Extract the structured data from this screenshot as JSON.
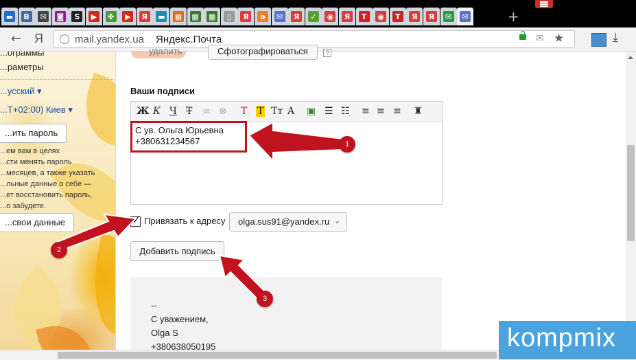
{
  "browser": {
    "tab_favicons": [
      {
        "glyph": "▬",
        "color": "#1e6fc9"
      },
      {
        "glyph": "В",
        "color": "#3b6ea5"
      },
      {
        "glyph": "✉",
        "color": "#444444"
      },
      {
        "glyph": "◙",
        "color": "#a0168c"
      },
      {
        "glyph": "S",
        "color": "#222222"
      },
      {
        "glyph": "▶",
        "color": "#d32a20"
      },
      {
        "glyph": "✤",
        "color": "#4a9a3a"
      },
      {
        "glyph": "▶",
        "color": "#d32a20"
      },
      {
        "glyph": "Я",
        "color": "#e03a3a"
      },
      {
        "glyph": "▬",
        "color": "#1e8fa8"
      },
      {
        "glyph": "▦",
        "color": "#e36c0a"
      },
      {
        "glyph": "▦",
        "color": "#3a7a2a"
      },
      {
        "glyph": "▦",
        "color": "#3a7a2a"
      },
      {
        "glyph": "▯",
        "color": "#999999"
      },
      {
        "glyph": "Я",
        "color": "#e03a3a"
      },
      {
        "glyph": "ə",
        "color": "#f08020"
      },
      {
        "glyph": "✉",
        "color": "#5a6fd0"
      },
      {
        "glyph": "Я",
        "color": "#e03a3a"
      },
      {
        "glyph": "✓",
        "color": "#58a030"
      },
      {
        "glyph": "◉",
        "color": "#d04040"
      },
      {
        "glyph": "Я",
        "color": "#e03a3a"
      },
      {
        "glyph": "T",
        "color": "#d02020"
      },
      {
        "glyph": "◉",
        "color": "#d04040"
      },
      {
        "glyph": "T",
        "color": "#d02020"
      },
      {
        "glyph": "Я",
        "color": "#e03a3a"
      },
      {
        "glyph": "Я",
        "color": "#e03a3a"
      },
      {
        "glyph": "✉",
        "color": "#2a9a4a"
      },
      {
        "glyph": "✉",
        "color": "#5a6fd0"
      }
    ],
    "back_glyph": "←",
    "yandex_btn": "Я",
    "url": "mail.yandex.ua",
    "page_title": "Яндекс.Почта"
  },
  "sidebar": {
    "item_programs": "...ограммы",
    "item_params": "...раметры",
    "language": "...усский ▾",
    "timezone": "...Т+02:00) Киев ▾",
    "change_password_btn": "...ить пароль",
    "security_text": [
      "...ем вам в целях",
      "...сти менять пароль",
      "...месяцев, а также указать",
      "...льные данные о себе —",
      "...ет восстановить пароль,",
      "...о забудете."
    ],
    "personal_data_btn": "...свои данные"
  },
  "settings": {
    "delete_link": "удалить",
    "photo_btn": "Сфотографироваться",
    "section_title": "Ваши подписи",
    "toolbar": [
      {
        "name": "bold-button",
        "glyph": "Ж"
      },
      {
        "name": "italic-button",
        "glyph": "К"
      },
      {
        "name": "underline-button",
        "glyph": "Ч"
      },
      {
        "name": "strikethrough-button",
        "glyph": "Т"
      },
      {
        "name": "link-button",
        "glyph": "∞"
      },
      {
        "name": "unlink-button",
        "glyph": "⊗"
      },
      {
        "name": "text-color-button",
        "glyph": "Т"
      },
      {
        "name": "bg-color-button",
        "glyph": "Т"
      },
      {
        "name": "font-size-button",
        "glyph": "Тт"
      },
      {
        "name": "clear-format-button",
        "glyph": "A"
      },
      {
        "name": "insert-image-button",
        "glyph": "▣"
      },
      {
        "name": "bullet-list-button",
        "glyph": "☰"
      },
      {
        "name": "numbered-list-button",
        "glyph": "☷"
      },
      {
        "name": "align-left-button",
        "glyph": "≡"
      },
      {
        "name": "align-center-button",
        "glyph": "≡"
      },
      {
        "name": "align-right-button",
        "glyph": "≡"
      },
      {
        "name": "format-painter-button",
        "glyph": "♜"
      }
    ],
    "signature_lines": [
      "С ув. Ольга Юрьевна",
      "+380631234567"
    ],
    "bind_label": "Привязать к адресу",
    "bind_address": "olga.sus91@yandex.ru",
    "add_signature_btn": "Добавить подпись",
    "existing_signature": [
      "--",
      "С уважением,",
      "Olga S",
      "+380638050195"
    ]
  },
  "annotations": [
    "1",
    "2",
    "3"
  ],
  "watermark": "kompmix",
  "colors": {
    "annotation_red": "#c1121f",
    "link_blue": "#1a4da1",
    "watermark_blue": "#4aa3df"
  }
}
